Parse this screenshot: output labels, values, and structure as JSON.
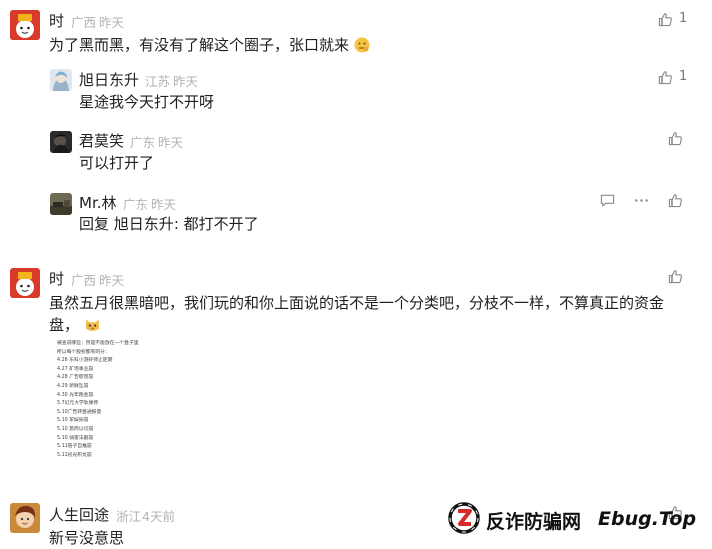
{
  "comments": [
    {
      "name": "时",
      "location": "广西",
      "time": "昨天",
      "text": "为了黑而黑，有没有了解这个圈子，张口就来",
      "likes": "1",
      "replies": [
        {
          "name": "旭日东升",
          "location": "江苏",
          "time": "昨天",
          "text": "星途我今天打不开呀",
          "likes": "1"
        },
        {
          "name": "君莫笑",
          "location": "广东",
          "time": "昨天",
          "text": "可以打开了"
        },
        {
          "name": "Mr.林",
          "location": "广东",
          "time": "昨天",
          "text_prefix": "回复",
          "reply_to": "旭日东升",
          "text_suffix": ": 都打不开了"
        }
      ]
    },
    {
      "name": "时",
      "location": "广西",
      "time": "昨天",
      "text_line1": "虽然五月很黑暗吧，我们玩的和你上面说的话不是一个分类吧，分枝不一样，不算真正的资金",
      "text_line2": "盘，",
      "image_lines": [
        "被查说哪些：然是不能放在一个盘子里",
        "所以每个股权都有的分：",
        "4.26 乐科小游奸师止匪期",
        "4.27 矿场事业崩",
        "4.28 广告歇营崩",
        "4.29 新鲜坠崩",
        "4.30 光年跑金崩",
        "5.7幻元大学轨弹停",
        "5.10广告转盘通报量",
        "5.10 军娱染崩",
        "5.10 旅周以切崩",
        "5.10 骑雷法剧崩",
        "5.11陪子自推崩",
        "5.11初光积龙崩"
      ]
    },
    {
      "name": "人生回途",
      "location": "浙江",
      "time": "4天前",
      "text": "新号没意思"
    }
  ],
  "watermark": {
    "cn": "反诈防骗网",
    "en": "Ebug.Top"
  },
  "colors": {
    "meta": "#b3b3b3",
    "text": "#1f1f1f",
    "icon": "#8a8a8a"
  }
}
